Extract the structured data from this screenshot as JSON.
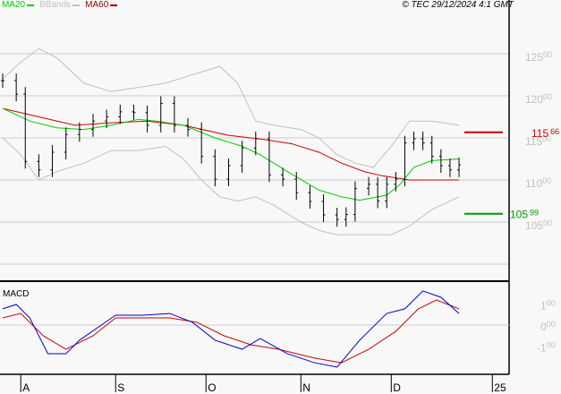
{
  "legend": [
    {
      "label": "MA20",
      "color": "#00cc00"
    },
    {
      "label": "BBands",
      "color": "#c0c0c0"
    },
    {
      "label": "MA60",
      "color": "#990000"
    }
  ],
  "copyright": "© TEC 29/12/2024 4:1 GMT",
  "chart_data": {
    "type": "line",
    "title": "",
    "x_unit": "trading day index",
    "x_range": [
      0,
      110
    ],
    "month_labels": [
      {
        "label": "A",
        "x": 4
      },
      {
        "label": "S",
        "x": 25
      },
      {
        "label": "O",
        "x": 45
      },
      {
        "label": "N",
        "x": 66
      },
      {
        "label": "D",
        "x": 86
      },
      {
        "label": "25",
        "x": 106
      }
    ],
    "price_panel": {
      "ylim": [
        10100,
        12900
      ],
      "yticks": [
        {
          "v": 12500,
          "major": "125",
          "minor": "00"
        },
        {
          "v": 12000,
          "major": "120",
          "minor": "00"
        },
        {
          "v": 11500,
          "major": "115",
          "minor": "00"
        },
        {
          "v": 11000,
          "major": "110",
          "minor": "00"
        },
        {
          "v": 10500,
          "major": "105",
          "minor": "00"
        }
      ],
      "grid_values": [
        12500,
        12000,
        11500,
        11000,
        10500,
        10000
      ],
      "price": [
        [
          0,
          12180
        ],
        [
          3,
          12020
        ],
        [
          5,
          11220
        ],
        [
          8,
          11120
        ],
        [
          11,
          11330
        ],
        [
          14,
          11540
        ],
        [
          17,
          11600
        ],
        [
          20,
          11700
        ],
        [
          23,
          11750
        ],
        [
          26,
          11810
        ],
        [
          29,
          11800
        ],
        [
          32,
          11650
        ],
        [
          35,
          11910
        ],
        [
          38,
          11650
        ],
        [
          41,
          11600
        ],
        [
          44,
          11280
        ],
        [
          47,
          11010
        ],
        [
          50,
          11170
        ],
        [
          53,
          11380
        ],
        [
          56,
          11490
        ],
        [
          59,
          11060
        ],
        [
          62,
          11010
        ],
        [
          65,
          10850
        ],
        [
          68,
          10745
        ],
        [
          71,
          10585
        ],
        [
          74,
          10530
        ],
        [
          76,
          10590
        ],
        [
          78,
          10900
        ],
        [
          81,
          10950
        ],
        [
          83,
          10750
        ],
        [
          85,
          10950
        ],
        [
          87,
          11010
        ],
        [
          89,
          11440
        ],
        [
          91,
          11490
        ],
        [
          93,
          11440
        ],
        [
          95,
          11280
        ],
        [
          97,
          11170
        ],
        [
          99,
          11120
        ],
        [
          101,
          11180
        ]
      ],
      "ma20": [
        [
          0,
          11850
        ],
        [
          6,
          11700
        ],
        [
          12,
          11620
        ],
        [
          18,
          11600
        ],
        [
          24,
          11650
        ],
        [
          30,
          11720
        ],
        [
          34,
          11700
        ],
        [
          40,
          11650
        ],
        [
          47,
          11500
        ],
        [
          53,
          11400
        ],
        [
          57,
          11300
        ],
        [
          63,
          11100
        ],
        [
          70,
          10880
        ],
        [
          75,
          10800
        ],
        [
          79,
          10760
        ],
        [
          85,
          10820
        ],
        [
          88,
          10950
        ],
        [
          91,
          11150
        ],
        [
          95,
          11230
        ],
        [
          101,
          11250
        ]
      ],
      "ma60": [
        [
          0,
          11850
        ],
        [
          8,
          11750
        ],
        [
          16,
          11650
        ],
        [
          24,
          11680
        ],
        [
          32,
          11700
        ],
        [
          40,
          11650
        ],
        [
          50,
          11530
        ],
        [
          58,
          11480
        ],
        [
          64,
          11430
        ],
        [
          70,
          11330
        ],
        [
          75,
          11200
        ],
        [
          80,
          11100
        ],
        [
          84,
          11050
        ],
        [
          90,
          11000
        ],
        [
          96,
          11000
        ],
        [
          101,
          11000
        ]
      ],
      "bb_upper": [
        [
          0,
          12200
        ],
        [
          4,
          12400
        ],
        [
          8,
          12560
        ],
        [
          12,
          12450
        ],
        [
          18,
          12150
        ],
        [
          24,
          12050
        ],
        [
          30,
          12100
        ],
        [
          36,
          12150
        ],
        [
          42,
          12250
        ],
        [
          48,
          12350
        ],
        [
          52,
          12150
        ],
        [
          56,
          11700
        ],
        [
          60,
          11650
        ],
        [
          66,
          11600
        ],
        [
          70,
          11500
        ],
        [
          74,
          11300
        ],
        [
          78,
          11200
        ],
        [
          82,
          11150
        ],
        [
          86,
          11400
        ],
        [
          90,
          11700
        ],
        [
          95,
          11700
        ],
        [
          101,
          11650
        ]
      ],
      "bb_lower": [
        [
          0,
          11500
        ],
        [
          4,
          11300
        ],
        [
          8,
          11000
        ],
        [
          12,
          11100
        ],
        [
          18,
          11200
        ],
        [
          24,
          11350
        ],
        [
          30,
          11350
        ],
        [
          36,
          11400
        ],
        [
          40,
          11250
        ],
        [
          44,
          11000
        ],
        [
          48,
          10800
        ],
        [
          52,
          10750
        ],
        [
          56,
          10800
        ],
        [
          60,
          10700
        ],
        [
          66,
          10500
        ],
        [
          70,
          10400
        ],
        [
          74,
          10350
        ],
        [
          80,
          10350
        ],
        [
          86,
          10350
        ],
        [
          90,
          10450
        ],
        [
          95,
          10650
        ],
        [
          101,
          10800
        ]
      ],
      "resistance": {
        "value": 11566,
        "major": "115",
        "minor": "66",
        "color": "#cc0000"
      },
      "support": {
        "value": 10599,
        "major": "105",
        "minor": "99",
        "color": "#009900"
      }
    },
    "macd_panel": {
      "label": "MACD",
      "ylim": [
        -230,
        205
      ],
      "yticks": [
        {
          "v": 100,
          "major": "1",
          "minor": "00"
        },
        {
          "v": 0,
          "major": "0",
          "minor": "00"
        },
        {
          "v": -100,
          "major": "-1",
          "minor": "00"
        }
      ],
      "macd": [
        [
          0,
          77
        ],
        [
          3,
          98
        ],
        [
          6,
          34
        ],
        [
          10,
          -136
        ],
        [
          14,
          -136
        ],
        [
          17,
          -72
        ],
        [
          25,
          47
        ],
        [
          31,
          47
        ],
        [
          37,
          55
        ],
        [
          42,
          13
        ],
        [
          47,
          -72
        ],
        [
          53,
          -115
        ],
        [
          57,
          -64
        ],
        [
          63,
          -136
        ],
        [
          69,
          -179
        ],
        [
          74,
          -200
        ],
        [
          79,
          -72
        ],
        [
          85,
          55
        ],
        [
          89,
          77
        ],
        [
          93,
          162
        ],
        [
          97,
          132
        ],
        [
          101,
          55
        ]
      ],
      "signal": [
        [
          0,
          34
        ],
        [
          4,
          55
        ],
        [
          9,
          -51
        ],
        [
          14,
          -115
        ],
        [
          20,
          -51
        ],
        [
          25,
          34
        ],
        [
          31,
          34
        ],
        [
          37,
          34
        ],
        [
          43,
          13
        ],
        [
          49,
          -51
        ],
        [
          55,
          -94
        ],
        [
          61,
          -115
        ],
        [
          69,
          -157
        ],
        [
          75,
          -179
        ],
        [
          81,
          -115
        ],
        [
          87,
          -30
        ],
        [
          92,
          77
        ],
        [
          96,
          119
        ],
        [
          101,
          77
        ]
      ]
    }
  }
}
